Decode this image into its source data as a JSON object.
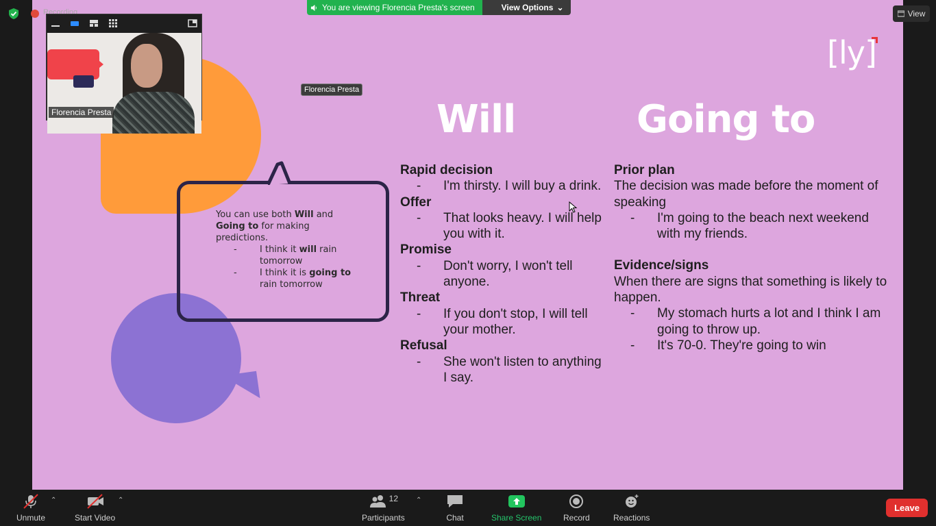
{
  "banner": {
    "viewing_text": "You are viewing Florencia Presta's screen",
    "view_options_label": "View Options"
  },
  "top_right": {
    "view_label": "View"
  },
  "recording": {
    "label": "Recording"
  },
  "video_panel": {
    "participant_name": "Florencia Presta"
  },
  "floating_name_tag": "Florencia Presta",
  "slide": {
    "logo_text": "[ly]",
    "bubble": {
      "intro_pre": "You can use both ",
      "intro_will": "Will",
      "intro_and": " and ",
      "intro_going": "Going to",
      "intro_post": " for making predictions.",
      "ex1_pre": "I think it ",
      "ex1_bold": "will",
      "ex1_post": " rain tomorrow",
      "ex2_pre": "I think it is ",
      "ex2_bold": "going to",
      "ex2_post": " rain tomorrow",
      "dash": "-"
    },
    "will": {
      "title": "Will",
      "sections": [
        {
          "heading": "Rapid decision",
          "example": "I'm thirsty. I will buy a drink."
        },
        {
          "heading": "Offer",
          "example": "That looks heavy. I will help you with it."
        },
        {
          "heading": "Promise",
          "example": "Don't worry, I won't tell anyone."
        },
        {
          "heading": "Threat",
          "example": "If you don't stop, I will tell your mother."
        },
        {
          "heading": "Refusal",
          "example": "She won't listen to anything I say."
        }
      ]
    },
    "going_to": {
      "title": "Going to",
      "prior_plan": {
        "heading": "Prior plan",
        "description": "The decision was made before the moment of speaking",
        "example": "I'm going to the beach next weekend with my friends."
      },
      "evidence": {
        "heading": "Evidence/signs",
        "description": "When there are signs that something is likely to happen.",
        "examples": [
          "My stomach hurts a lot and I think I am going to throw up.",
          "It's 70-0. They're going to win"
        ]
      }
    }
  },
  "toolbar": {
    "unmute": "Unmute",
    "start_video": "Start Video",
    "participants": "Participants",
    "participants_count": "12",
    "chat": "Chat",
    "share_screen": "Share Screen",
    "record": "Record",
    "reactions": "Reactions",
    "leave": "Leave"
  },
  "colors": {
    "slide_bg": "#dda6de",
    "banner_green": "#21b24e",
    "leave_red": "#e0302e",
    "share_green": "#25c46b"
  }
}
